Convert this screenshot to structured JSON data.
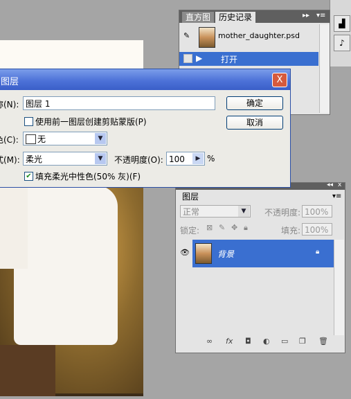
{
  "history_panel": {
    "tabs": [
      "直方图",
      "历史记录"
    ],
    "snapshot_name": "mother_daughter.psd",
    "items": [
      "打开"
    ]
  },
  "dialog": {
    "title": "图层",
    "close_label": "X",
    "name_label": "称(N):",
    "name_value": "图层 1",
    "use_prev_label": "使用前一图层创建剪贴蒙版(P)",
    "color_label": "色(C):",
    "color_value": "无",
    "mode_label": "式(M):",
    "mode_value": "柔光",
    "opacity_label": "不透明度(O):",
    "opacity_value": "100",
    "opacity_unit": "%",
    "fill_label": "填充柔光中性色(50% 灰)(F)",
    "fill_checked": true,
    "ok_label": "确定",
    "cancel_label": "取消"
  },
  "layers_panel": {
    "tab": "图层",
    "blend_mode": "正常",
    "opacity_label": "不透明度:",
    "opacity_value": "100%",
    "lock_label": "锁定:",
    "fill_label": "填充:",
    "fill_value": "100%",
    "layer_name": "背景"
  }
}
